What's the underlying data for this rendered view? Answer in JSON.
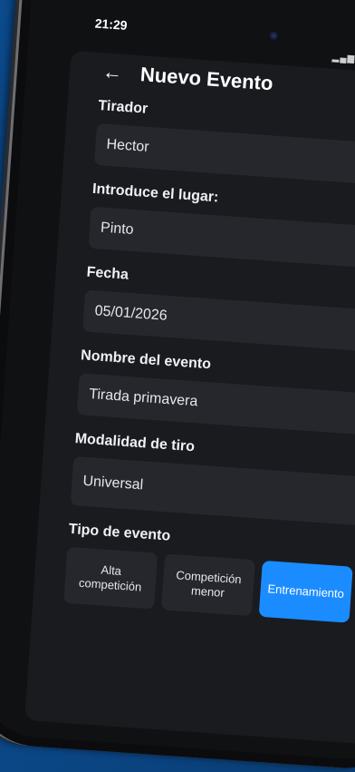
{
  "status": {
    "time": "21:29"
  },
  "header": {
    "back_icon": "arrow-left-icon",
    "title": "Nuevo Evento"
  },
  "form": {
    "tirador": {
      "label": "Tirador",
      "value": "Hector"
    },
    "lugar": {
      "label": "Introduce el lugar:",
      "value": "Pinto"
    },
    "fecha": {
      "label": "Fecha",
      "value": "05/01/2026"
    },
    "nombre": {
      "label": "Nombre del evento",
      "value": "Tirada primavera"
    },
    "modalidad": {
      "label": "Modalidad de tiro",
      "value": "Universal",
      "icon": "chevron-down-icon"
    },
    "tipo": {
      "label": "Tipo de evento",
      "options": [
        "Alta competición",
        "Competición menor",
        "Entrenamiento"
      ],
      "selected": "Entrenamiento"
    }
  },
  "colors": {
    "accent": "#1a8cff",
    "background": "#1a1b1f",
    "field": "#26272c"
  }
}
